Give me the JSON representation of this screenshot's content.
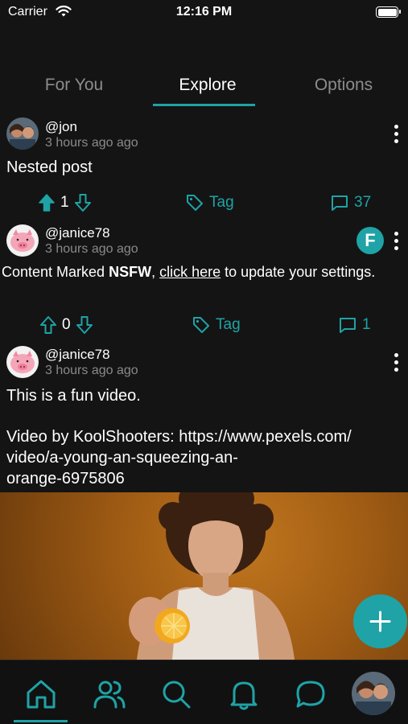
{
  "status_bar": {
    "carrier": "Carrier",
    "time": "12:16 PM"
  },
  "tabs": [
    {
      "label": "For You",
      "active": false
    },
    {
      "label": "Explore",
      "active": true
    },
    {
      "label": "Options",
      "active": false
    }
  ],
  "posts": [
    {
      "username": "@jon",
      "time_ago": "3 hours ago ago",
      "text": "Nested post",
      "vote_count": "1",
      "upvoted": true,
      "tag_label": "Tag",
      "comment_count": "37"
    },
    {
      "username": "@janice78",
      "time_ago": "3 hours ago ago",
      "badge_letter": "F",
      "nsfw_prefix": "Content Marked ",
      "nsfw_bold": "NSFW",
      "nsfw_comma": ", ",
      "nsfw_link": "click here",
      "nsfw_suffix": " to update your settings.",
      "vote_count": "0",
      "upvoted": false,
      "tag_label": "Tag",
      "comment_count": "1"
    },
    {
      "username": "@janice78",
      "time_ago": "3 hours ago ago",
      "text_line1": "This is a fun video.",
      "text_line2": "Video by KoolShooters: https://www.pexels.com/",
      "text_line3": "video/a-young-an-squeezing-an-",
      "text_line4": "orange-6975806"
    }
  ],
  "fab": {
    "icon": "plus-icon"
  },
  "bottom_nav": [
    {
      "icon": "home-icon",
      "active": true
    },
    {
      "icon": "people-icon",
      "active": false
    },
    {
      "icon": "search-icon",
      "active": false
    },
    {
      "icon": "bell-icon",
      "active": false
    },
    {
      "icon": "chat-bubble-icon",
      "active": false
    },
    {
      "icon": "profile-avatar",
      "active": false
    }
  ],
  "colors": {
    "accent": "#1fa3a6",
    "background": "#141414",
    "muted_text": "#8a8a8a"
  }
}
